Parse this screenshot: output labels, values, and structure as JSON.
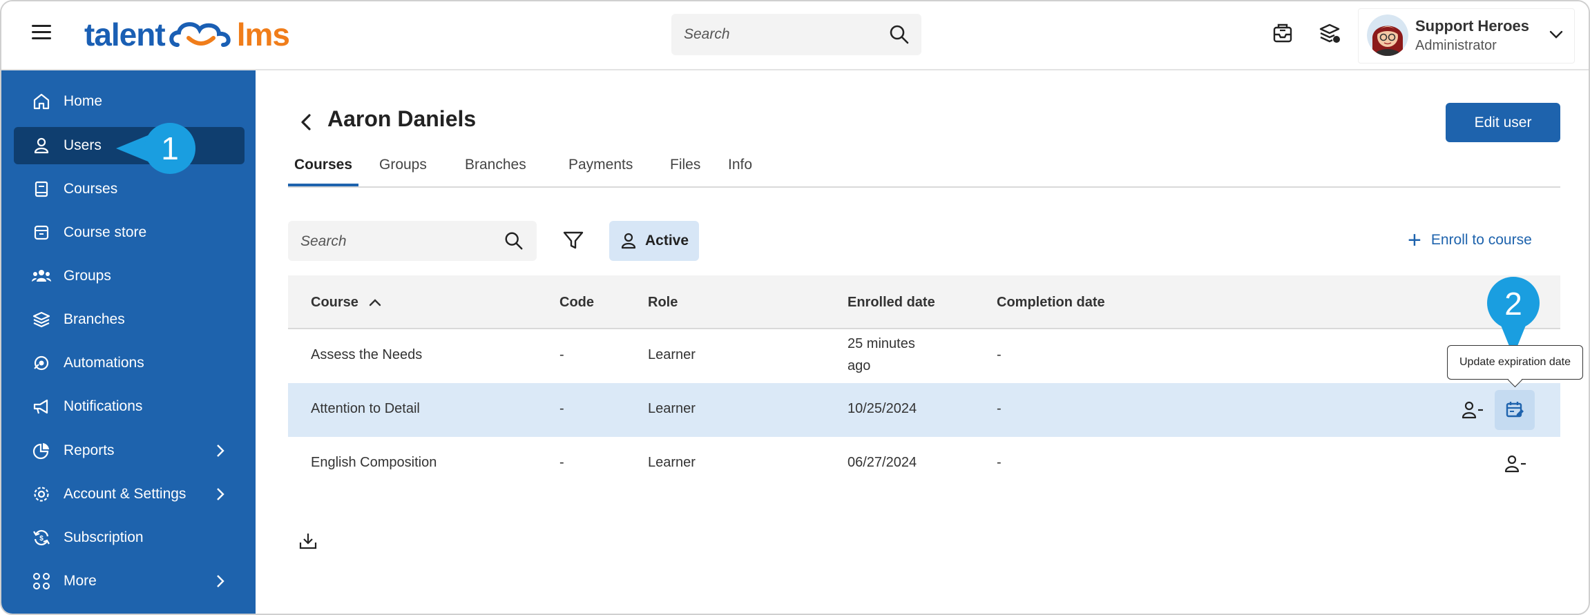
{
  "brand": {
    "logo_left": "talent",
    "logo_right": "lms"
  },
  "topbar": {
    "search_placeholder": "Search",
    "user_name": "Support Heroes",
    "user_role": "Administrator"
  },
  "sidebar": {
    "items": [
      {
        "label": "Home",
        "icon": "home-icon"
      },
      {
        "label": "Users",
        "icon": "user-icon"
      },
      {
        "label": "Courses",
        "icon": "book-icon"
      },
      {
        "label": "Course store",
        "icon": "store-icon"
      },
      {
        "label": "Groups",
        "icon": "groups-icon"
      },
      {
        "label": "Branches",
        "icon": "layers-icon"
      },
      {
        "label": "Automations",
        "icon": "automation-icon"
      },
      {
        "label": "Notifications",
        "icon": "megaphone-icon"
      },
      {
        "label": "Reports",
        "icon": "pie-chart-icon"
      },
      {
        "label": "Account & Settings",
        "icon": "gear-icon"
      },
      {
        "label": "Subscription",
        "icon": "subscription-icon"
      },
      {
        "label": "More",
        "icon": "grid-icon"
      }
    ]
  },
  "page": {
    "title": "Aaron Daniels",
    "edit_button": "Edit user",
    "tabs": [
      "Courses",
      "Groups",
      "Branches",
      "Payments",
      "Files",
      "Info"
    ],
    "search_placeholder": "Search",
    "active_filter": "Active",
    "enroll_label": "Enroll to course"
  },
  "table": {
    "headers": [
      "Course",
      "Code",
      "Role",
      "Enrolled date",
      "Completion date"
    ],
    "rows": [
      {
        "course": "Assess the Needs",
        "code": "-",
        "role": "Learner",
        "enrolled_1": "25 minutes",
        "enrolled_2": "ago",
        "completion": "-"
      },
      {
        "course": "Attention to Detail",
        "code": "-",
        "role": "Learner",
        "enrolled": "10/25/2024",
        "completion": "-"
      },
      {
        "course": "English Composition",
        "code": "-",
        "role": "Learner",
        "enrolled": "06/27/2024",
        "completion": "-"
      }
    ]
  },
  "tooltip": "Update expiration date",
  "callouts": {
    "one": "1",
    "two": "2"
  },
  "colors": {
    "primary": "#1e63ad",
    "active_nav": "#0f3e6f",
    "callout": "#1a9ee0",
    "highlight_row": "#dbe9f7"
  }
}
